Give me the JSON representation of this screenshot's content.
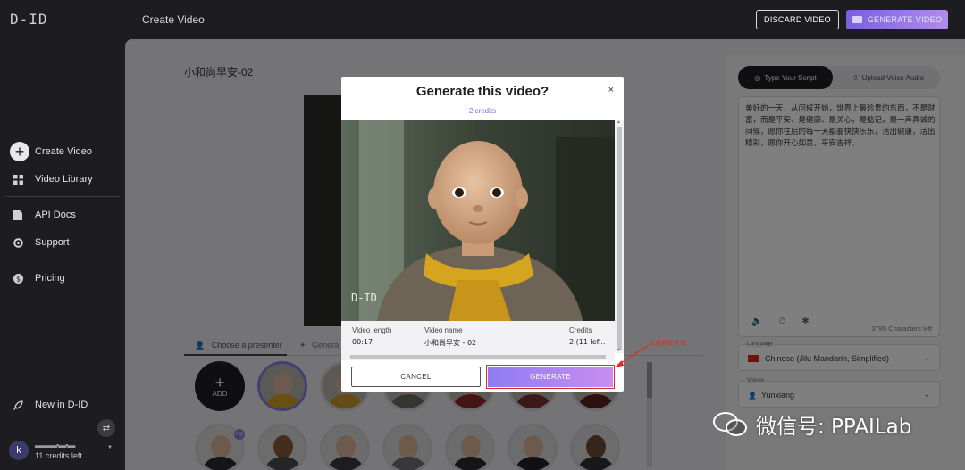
{
  "app": {
    "logo": "D-ID",
    "page_title": "Create Video"
  },
  "sidebar": {
    "create_video": "Create Video",
    "items": [
      {
        "label": "Video Library",
        "icon": "grid-icon"
      },
      {
        "label": "API Docs",
        "icon": "document-icon"
      },
      {
        "label": "Support",
        "icon": "lifebuoy-icon"
      },
      {
        "label": "Pricing",
        "icon": "coin-icon"
      }
    ],
    "new_in": "New in D-ID",
    "account": {
      "avatar_letter": "k",
      "name": "▬▬▬▪▬▪▬",
      "credits_left": "11 credits left"
    }
  },
  "topbar": {
    "discard_label": "DISCARD VIDEO",
    "generate_label": "GENERATE VIDEO"
  },
  "editor": {
    "video_title": "小和尚早安-02",
    "tabs": {
      "presenter": "Choose a presenter",
      "generate": "Genera"
    },
    "add_label": "ADD",
    "hq_badge": "HQ"
  },
  "right_panel": {
    "tab_script": "Type Your Script",
    "tab_audio": "Upload Voice Audio",
    "script_text": "美好的一天，从问候开始，世界上最珍贵的东西，不是财富，而是平安、是健康、是关心，是惦记，是一声真诚的问候，愿你往后的每一天都要快快乐乐，活出健康，活出精彩，愿你开心如意，平安吉祥。",
    "char_count": "3785 Characters left",
    "language_label": "Language",
    "language_value": "Chinese (Jilu Mandarin, Simplified)",
    "voices_label": "Voices",
    "voice_value": "Yunxiang"
  },
  "modal": {
    "title": "Generate this video?",
    "close": "×",
    "credits": "2 credits",
    "watermark": "D-ID",
    "info": [
      {
        "key": "Video length",
        "value": "00:17"
      },
      {
        "key": "Video name",
        "value": "小和尚早安 - 02"
      },
      {
        "key": "Credits",
        "value": "2 (11 lef..."
      }
    ],
    "cancel_label": "CANCEL",
    "generate_label": "GENERATE"
  },
  "annotation": "点击开始生成",
  "wechat_watermark": "微信号: PPAILab",
  "colors": {
    "accent": "#8f7cf2",
    "sidebar_bg": "#1d1d20",
    "annotation_red": "#e02828"
  }
}
